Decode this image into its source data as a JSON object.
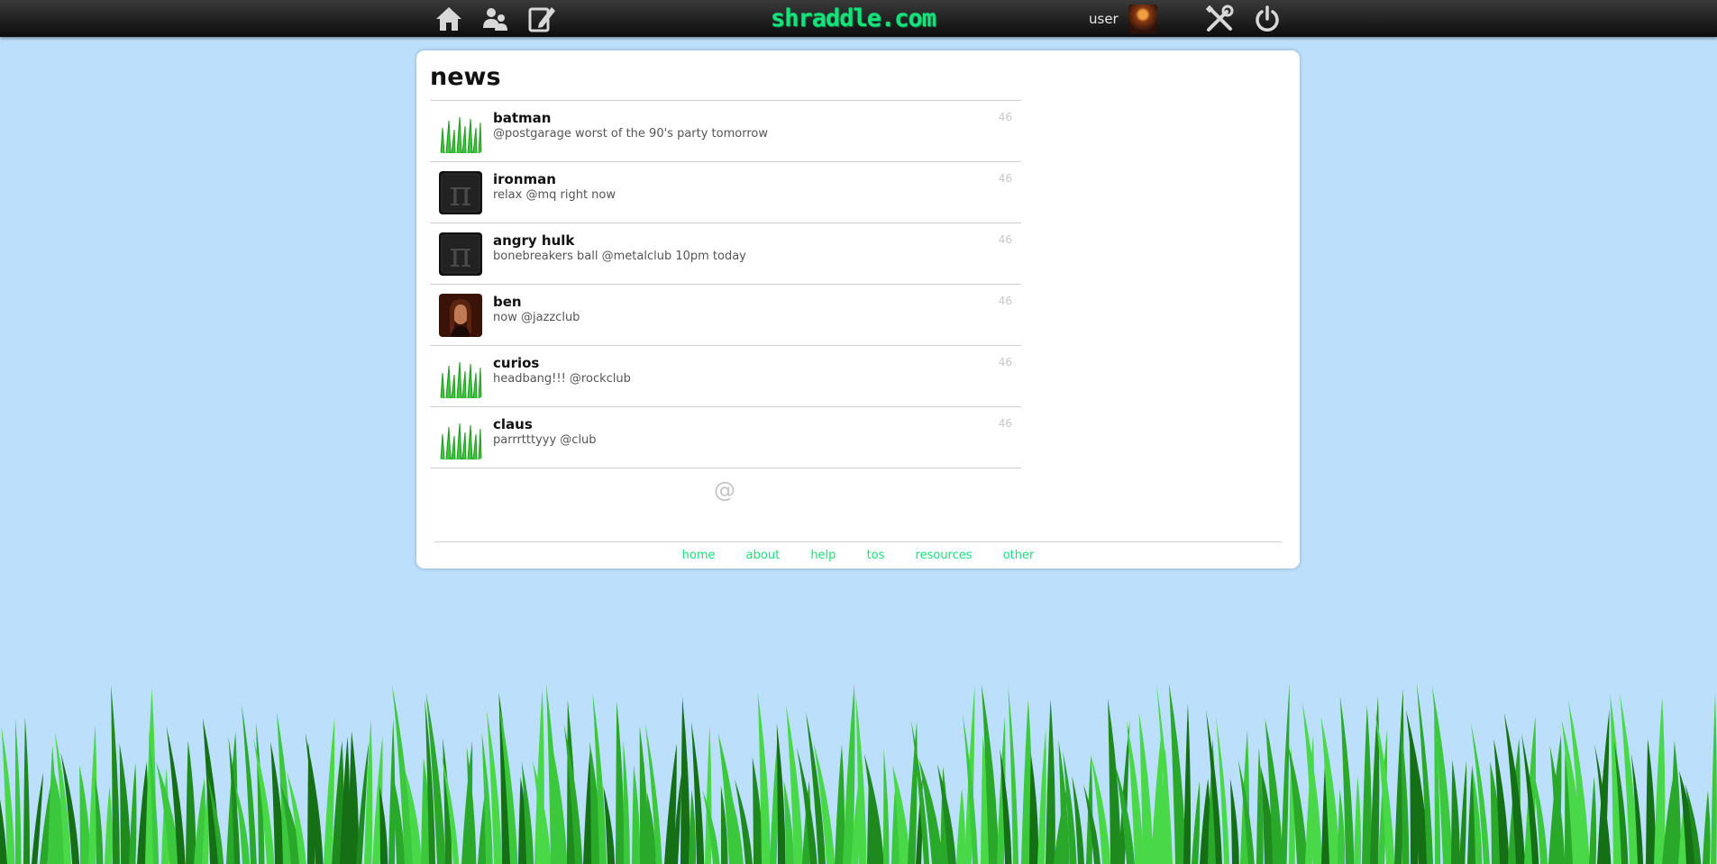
{
  "header": {
    "logo": "shraddle.com",
    "user_name": "user",
    "nav": [
      "home-icon",
      "friends-icon",
      "compose-icon",
      "settings-icon",
      "power-icon"
    ]
  },
  "main": {
    "title": "news",
    "feed": [
      {
        "user": "batman",
        "text": "@postgarage worst of the 90's party tomorrow",
        "time": "46",
        "avatar": "grass"
      },
      {
        "user": "ironman",
        "text": "relax @mq right now",
        "time": "46",
        "avatar": "pi"
      },
      {
        "user": "angry hulk",
        "text": "bonebreakers ball @metalclub 10pm today",
        "time": "46",
        "avatar": "pi"
      },
      {
        "user": "ben",
        "text": "now @jazzclub",
        "time": "46",
        "avatar": "photo"
      },
      {
        "user": "curios",
        "text": "headbang!!! @rockclub",
        "time": "46",
        "avatar": "grass"
      },
      {
        "user": "claus",
        "text": "parrrtttyyy @club",
        "time": "46",
        "avatar": "grass"
      }
    ],
    "at_symbol": "@"
  },
  "footer": {
    "links": [
      "home",
      "about",
      "help",
      "tos",
      "resources",
      "other"
    ]
  },
  "colors": {
    "background": "#bcdffb",
    "accent": "#19e07a",
    "topbar": "#0c0c0c"
  }
}
